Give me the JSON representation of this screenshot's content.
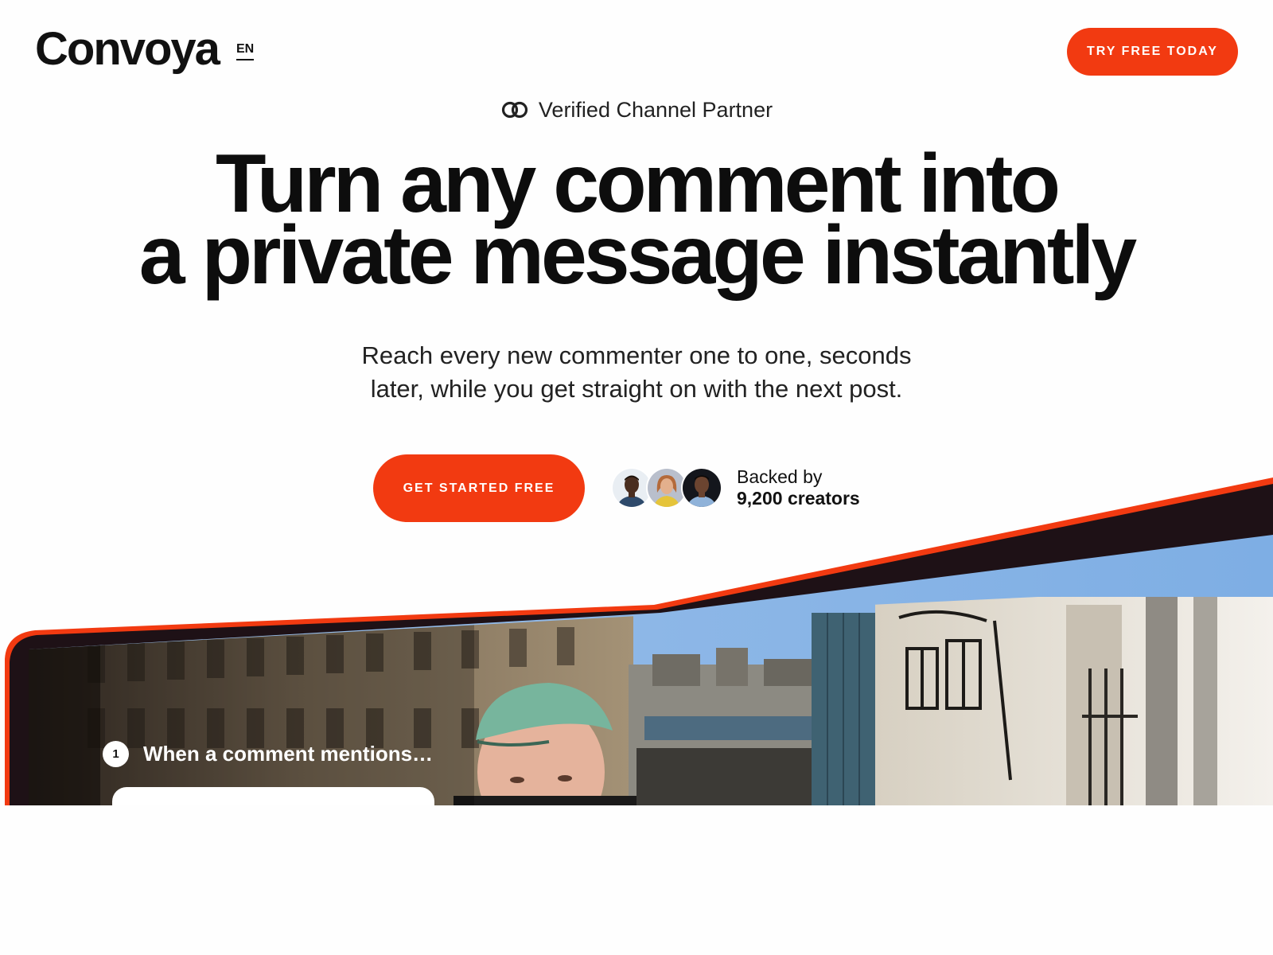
{
  "header": {
    "logo": "Convoya",
    "language": "EN",
    "cta_label": "TRY FREE TODAY"
  },
  "hero": {
    "badge_icon": "linked-rings-icon",
    "badge_text": "Verified Channel Partner",
    "title_lines": [
      "Turn any comment into",
      "a private message instantly"
    ],
    "subtitle_lines": [
      "Reach every new commenter one to one, seconds",
      "later, while you get straight on with the next post."
    ],
    "cta_label": "GET STARTED FREE"
  },
  "social_proof": {
    "line1": "Backed by",
    "line2": "9,200 creators",
    "avatars": [
      "avatar-creator-1",
      "avatar-creator-2",
      "avatar-creator-3"
    ]
  },
  "showcase": {
    "step_number": "1",
    "step_label": "When a comment mentions…"
  },
  "colors": {
    "accent": "#f23a11",
    "text": "#111111",
    "background": "#fefefe",
    "dark_band": "#1e1116",
    "sky_band": "#8ab4e6"
  }
}
